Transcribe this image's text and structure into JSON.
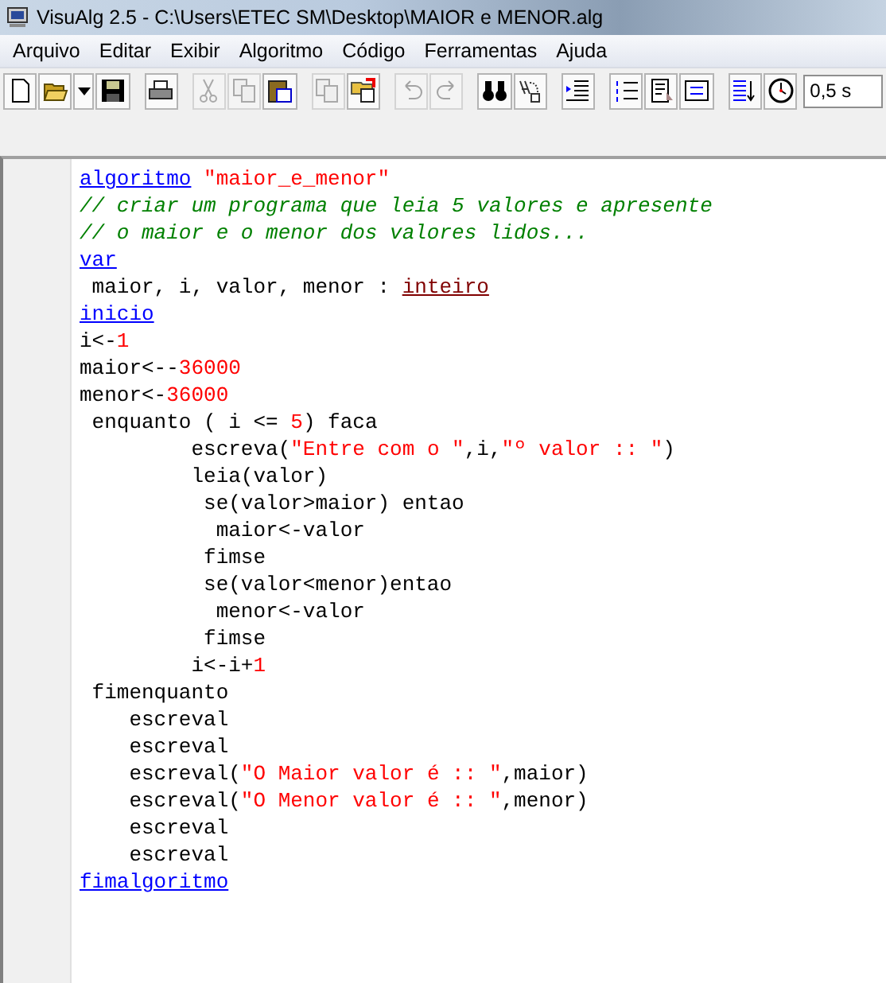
{
  "window": {
    "title": "VisuAlg 2.5 - C:\\Users\\ETEC SM\\Desktop\\MAIOR e MENOR.alg"
  },
  "menu": [
    "Arquivo",
    "Editar",
    "Exibir",
    "Algoritmo",
    "Código",
    "Ferramentas",
    "Ajuda"
  ],
  "toolbar": [
    [
      {
        "kind": "new",
        "disabled": false
      },
      {
        "kind": "open",
        "disabled": false
      },
      {
        "kind": "dropdown",
        "disabled": false
      },
      {
        "kind": "save",
        "disabled": false
      }
    ],
    [
      {
        "kind": "print",
        "disabled": false
      }
    ],
    [
      {
        "kind": "cut",
        "disabled": true
      },
      {
        "kind": "copy",
        "disabled": true
      },
      {
        "kind": "paste",
        "disabled": false
      }
    ],
    [
      {
        "kind": "copy",
        "disabled": true
      },
      {
        "kind": "export",
        "disabled": false
      }
    ],
    [
      {
        "kind": "undo",
        "disabled": true
      },
      {
        "kind": "redo",
        "disabled": true
      }
    ],
    [
      {
        "kind": "find",
        "disabled": false
      },
      {
        "kind": "replace",
        "disabled": false
      }
    ],
    [
      {
        "kind": "indent",
        "disabled": false
      }
    ],
    [
      {
        "kind": "numbered",
        "disabled": false
      },
      {
        "kind": "document",
        "disabled": false
      },
      {
        "kind": "frame",
        "disabled": false
      }
    ],
    [
      {
        "kind": "sort",
        "disabled": false
      },
      {
        "kind": "clock",
        "disabled": false
      }
    ]
  ],
  "timer_field": {
    "value": "0,5 s"
  },
  "code": [
    [
      {
        "kind": "keyword",
        "text": "algoritmo"
      },
      {
        "kind": "string",
        "text": " \"maior_e_menor\""
      }
    ],
    [
      {
        "kind": "comment",
        "text": "// criar um programa que leia 5 valores e apresente"
      }
    ],
    [
      {
        "kind": "comment",
        "text": "// o maior e o menor dos valores lidos..."
      }
    ],
    [
      {
        "kind": "keyword",
        "text": "var"
      }
    ],
    [
      {
        "kind": "plain",
        "text": " maior, i, valor, menor : "
      },
      {
        "kind": "type",
        "text": "inteiro"
      }
    ],
    [
      {
        "kind": "keyword",
        "text": "inicio"
      }
    ],
    [
      {
        "kind": "plain",
        "text": "i<-"
      },
      {
        "kind": "number",
        "text": "1"
      }
    ],
    [
      {
        "kind": "plain",
        "text": "maior<--"
      },
      {
        "kind": "number",
        "text": "36000"
      }
    ],
    [
      {
        "kind": "plain",
        "text": "menor<-"
      },
      {
        "kind": "number",
        "text": "36000"
      }
    ],
    [
      {
        "kind": "plain",
        "text": " enquanto ( i <= "
      },
      {
        "kind": "number",
        "text": "5"
      },
      {
        "kind": "plain",
        "text": ") faca"
      }
    ],
    [
      {
        "kind": "plain",
        "text": "         escreva("
      },
      {
        "kind": "string",
        "text": "\"Entre com o \""
      },
      {
        "kind": "plain",
        "text": ",i,"
      },
      {
        "kind": "string",
        "text": "\"º valor :: \""
      },
      {
        "kind": "plain",
        "text": ")"
      }
    ],
    [
      {
        "kind": "plain",
        "text": "         leia(valor)"
      }
    ],
    [
      {
        "kind": "plain",
        "text": "          se(valor>maior) entao"
      }
    ],
    [
      {
        "kind": "plain",
        "text": "           maior<-valor"
      }
    ],
    [
      {
        "kind": "plain",
        "text": "          fimse"
      }
    ],
    [
      {
        "kind": "plain",
        "text": "          se(valor<menor)entao"
      }
    ],
    [
      {
        "kind": "plain",
        "text": "           menor<-valor"
      }
    ],
    [
      {
        "kind": "plain",
        "text": "          fimse"
      }
    ],
    [
      {
        "kind": "plain",
        "text": "         i<-i+"
      },
      {
        "kind": "number",
        "text": "1"
      }
    ],
    [
      {
        "kind": "plain",
        "text": " fimenquanto"
      }
    ],
    [
      {
        "kind": "plain",
        "text": "    escreval"
      }
    ],
    [
      {
        "kind": "plain",
        "text": "    escreval"
      }
    ],
    [
      {
        "kind": "plain",
        "text": "    escreval("
      },
      {
        "kind": "string",
        "text": "\"O Maior valor é :: \""
      },
      {
        "kind": "plain",
        "text": ",maior)"
      }
    ],
    [
      {
        "kind": "plain",
        "text": "    escreval("
      },
      {
        "kind": "string",
        "text": "\"O Menor valor é :: \""
      },
      {
        "kind": "plain",
        "text": ",menor)"
      }
    ],
    [
      {
        "kind": "plain",
        "text": "    escreval"
      }
    ],
    [
      {
        "kind": "plain",
        "text": "    escreval"
      }
    ],
    [
      {
        "kind": "keyword",
        "text": "fimalgoritmo"
      }
    ]
  ]
}
